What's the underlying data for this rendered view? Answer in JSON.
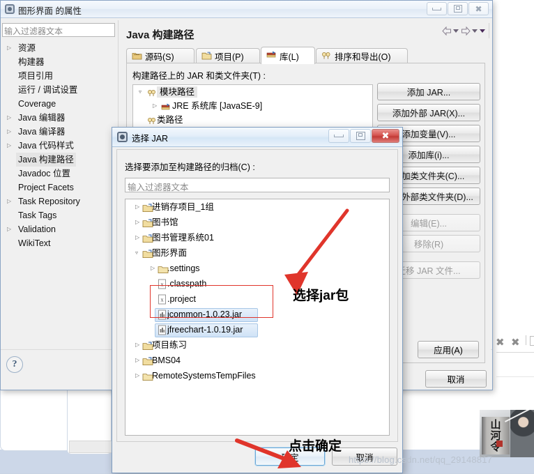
{
  "properties_window": {
    "title": "图形界面 的属性",
    "title_icon": "eclipse-properties-icon",
    "window_buttons": {
      "minimize": "minimize-icon",
      "maximize": "maximize-icon",
      "close": "close-icon"
    },
    "filter": {
      "placeholder": "输入过滤器文本",
      "value": ""
    },
    "nav_items": [
      {
        "label": "资源",
        "expandable": true,
        "selected": false
      },
      {
        "label": "构建器",
        "expandable": false,
        "selected": false
      },
      {
        "label": "项目引用",
        "expandable": false,
        "selected": false
      },
      {
        "label": "运行 / 调试设置",
        "expandable": false,
        "selected": false
      },
      {
        "label": "Coverage",
        "expandable": false,
        "selected": false
      },
      {
        "label": "Java 编辑器",
        "expandable": true,
        "selected": false
      },
      {
        "label": "Java 编译器",
        "expandable": true,
        "selected": false
      },
      {
        "label": "Java 代码样式",
        "expandable": true,
        "selected": false
      },
      {
        "label": "Java 构建路径",
        "expandable": false,
        "selected": true
      },
      {
        "label": "Javadoc 位置",
        "expandable": false,
        "selected": false
      },
      {
        "label": "Project Facets",
        "expandable": false,
        "selected": false
      },
      {
        "label": "Task Repository",
        "expandable": true,
        "selected": false
      },
      {
        "label": "Task Tags",
        "expandable": false,
        "selected": false
      },
      {
        "label": "Validation",
        "expandable": true,
        "selected": false
      },
      {
        "label": "WikiText",
        "expandable": false,
        "selected": false
      }
    ],
    "help_label": "?",
    "page_title": "Java 构建路径",
    "nav_back": "back-arrow-icon",
    "nav_forward": "forward-arrow-icon",
    "tabs": [
      {
        "label": "源码(S)",
        "icon": "source-folder-icon",
        "active": false
      },
      {
        "label": "项目(P)",
        "icon": "project-folder-icon",
        "active": false
      },
      {
        "label": "库(L)",
        "icon": "library-books-icon",
        "active": true
      },
      {
        "label": "排序和导出(O)",
        "icon": "order-export-icon",
        "active": false
      }
    ],
    "classpath_label": "构建路径上的 JAR 和类文件夹(T) :",
    "classpath_tree": [
      {
        "label": "模块路径",
        "icon": "module-path-icon",
        "indent": 0,
        "twisty": "expanded"
      },
      {
        "label": "JRE 系统库 [JavaSE-9]",
        "icon": "library-books-icon",
        "indent": 1,
        "twisty": "collapsed"
      },
      {
        "label": "类路径",
        "icon": "class-path-icon",
        "indent": 0,
        "twisty": "none"
      }
    ],
    "side_buttons": [
      {
        "label": "添加 JAR...",
        "enabled": true
      },
      {
        "label": "添加外部 JAR(X)...",
        "enabled": true
      },
      {
        "label": "添加变量(V)...",
        "enabled": true
      },
      {
        "label": "添加库(i)...",
        "enabled": true
      },
      {
        "label": "添加类文件夹(C)...",
        "enabled": true
      },
      {
        "label": "添加外部类文件夹(D)...",
        "enabled": true
      },
      {
        "label": "编辑(E)...",
        "enabled": false
      },
      {
        "label": "移除(R)",
        "enabled": false
      },
      {
        "label": "迁移 JAR 文件...",
        "enabled": false
      }
    ],
    "apply_label": "应用(A)",
    "cancel_label": "取消"
  },
  "jar_dialog": {
    "title": "选择 JAR",
    "title_icon": "eclipse-dialog-icon",
    "window_buttons": {
      "minimize": "minimize-icon",
      "maximize": "maximize-icon",
      "close": "close-icon"
    },
    "prompt": "选择要添加至构建路径的归档(C) :",
    "filter": {
      "placeholder": "输入过滤器文本",
      "value": ""
    },
    "tree": [
      {
        "label": "进销存项目_1组",
        "icon": "project-folder-icon",
        "indent": 0,
        "twisty": "collapsed",
        "selected": false
      },
      {
        "label": "图书馆",
        "icon": "project-folder-icon",
        "indent": 0,
        "twisty": "collapsed",
        "selected": false
      },
      {
        "label": "图书管理系统01",
        "icon": "project-folder-icon",
        "indent": 0,
        "twisty": "collapsed",
        "selected": false
      },
      {
        "label": "图形界面",
        "icon": "project-folder-icon",
        "indent": 0,
        "twisty": "expanded",
        "selected": false
      },
      {
        "label": ".settings",
        "icon": "folder-icon",
        "indent": 1,
        "twisty": "collapsed",
        "selected": false
      },
      {
        "label": ".classpath",
        "icon": "xml-file-icon",
        "indent": 2,
        "twisty": "none",
        "selected": false
      },
      {
        "label": ".project",
        "icon": "xml-file-icon",
        "indent": 2,
        "twisty": "none",
        "selected": false
      },
      {
        "label": "jcommon-1.0.23.jar",
        "icon": "jar-file-icon",
        "indent": 2,
        "twisty": "none",
        "selected": true
      },
      {
        "label": "jfreechart-1.0.19.jar",
        "icon": "jar-file-icon",
        "indent": 2,
        "twisty": "none",
        "selected": true
      },
      {
        "label": "项目练习",
        "icon": "project-folder-icon",
        "indent": 0,
        "twisty": "collapsed",
        "selected": false
      },
      {
        "label": "BMS04",
        "icon": "project-folder-icon",
        "indent": 0,
        "twisty": "collapsed",
        "selected": false
      },
      {
        "label": "RemoteSystemsTempFiles",
        "icon": "folder-icon",
        "indent": 0,
        "twisty": "collapsed",
        "selected": false
      }
    ],
    "ok_label": "确定",
    "cancel_label": "取消"
  },
  "annotations": [
    {
      "text": "选择jar包",
      "kind": "red-arrow-callout"
    },
    {
      "text": "点击确定",
      "kind": "red-arrow-callout"
    }
  ],
  "watermark": "https://blog.csdn.net/qq_29148817",
  "overlay_icons": [
    {
      "name": "close-marker-icon"
    },
    {
      "name": "clear-markers-icon"
    }
  ],
  "ad_banner": {
    "text": "山河令",
    "name": "ad-banner"
  },
  "colors": {
    "annotation_red": "#e0352b",
    "dialog_border": "#7f9dc0",
    "selection_blue": "#cfe2f6",
    "watermark": "#b9c2ce"
  }
}
